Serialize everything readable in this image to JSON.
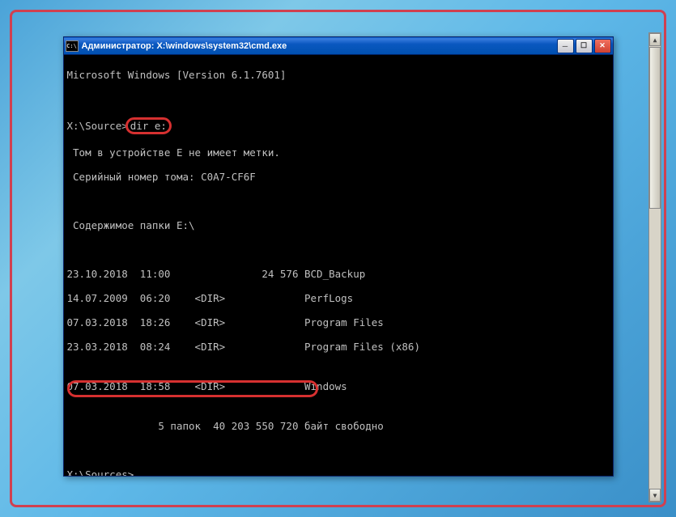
{
  "window": {
    "title": "Администратор: X:\\windows\\system32\\cmd.exe",
    "icon_label": "C:\\"
  },
  "terminal": {
    "version_line": "Microsoft Windows [Version 6.1.7601]",
    "prompt1_path": "X:\\Source>",
    "prompt1_cmd": "dir e:",
    "vol_line": " Том в устройстве E не имеет метки.",
    "serial_line": " Серийный номер тома: C0A7-CF6F",
    "contents_line": " Содержимое папки E:\\",
    "rows": [
      {
        "date": "23.10.2018",
        "time": "11:00",
        "type": "",
        "size": "24 576",
        "name": "BCD_Backup"
      },
      {
        "date": "14.07.2009",
        "time": "06:20",
        "type": "<DIR>",
        "size": "",
        "name": "PerfLogs"
      },
      {
        "date": "07.03.2018",
        "time": "18:26",
        "type": "<DIR>",
        "size": "",
        "name": "Program Files"
      },
      {
        "date": "23.03.2018",
        "time": "08:24",
        "type": "<DIR>",
        "size": "",
        "name": "Program Files (x86)"
      },
      {
        "date": "07.03.2018",
        "time": "18:58",
        "type": "<DIR>",
        "size": "",
        "name": "Windows"
      }
    ],
    "summary_folders": "               5 папок  40 203 550 720 байт свободно",
    "prompt2": "X:\\Sources>"
  }
}
